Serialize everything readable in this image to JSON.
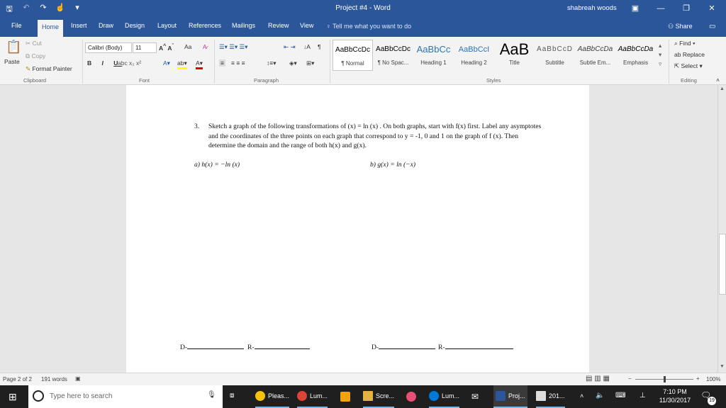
{
  "window": {
    "title": "Project #4  -  Word",
    "user": "shabreah woods"
  },
  "tabs": [
    {
      "label": "File"
    },
    {
      "label": "Home",
      "active": true
    },
    {
      "label": "Insert"
    },
    {
      "label": "Draw"
    },
    {
      "label": "Design"
    },
    {
      "label": "Layout"
    },
    {
      "label": "References"
    },
    {
      "label": "Mailings"
    },
    {
      "label": "Review"
    },
    {
      "label": "View"
    }
  ],
  "tell_me": "Tell me what you want to do",
  "share_label": "Share",
  "ribbon": {
    "clipboard": {
      "paste": "Paste",
      "cut": "Cut",
      "copy": "Copy",
      "format_painter": "Format Painter",
      "label": "Clipboard"
    },
    "font": {
      "name": "Calibri (Body)",
      "size": "11",
      "label": "Font",
      "change_case": "Aa"
    },
    "paragraph": {
      "label": "Paragraph"
    },
    "styles": {
      "label": "Styles",
      "items": [
        {
          "preview": "AaBbCcDc",
          "name": "¶ Normal"
        },
        {
          "preview": "AaBbCcDc",
          "name": "¶ No Spac..."
        },
        {
          "preview": "AaBbCc",
          "name": "Heading 1"
        },
        {
          "preview": "AaBbCcI",
          "name": "Heading 2"
        },
        {
          "preview": "AaB",
          "name": "Title"
        },
        {
          "preview": "AaBbCcD",
          "name": "Subtitle"
        },
        {
          "preview": "AaBbCcDa",
          "name": "Subtle Em..."
        },
        {
          "preview": "AaBbCcDa",
          "name": "Emphasis"
        }
      ]
    },
    "editing": {
      "find": "Find",
      "replace": "Replace",
      "select": "Select",
      "label": "Editing"
    }
  },
  "document": {
    "question_number": "3.",
    "question_text": "Sketch a graph of the following transformations of (x) = ln (x) . On both graphs, start with f(x) first. Label any asymptotes and the coordinates of the three points on each graph that correspond to y = -1, 0 and 1 on the graph of f (x). Then determine the domain and the range of both h(x) and g(x).",
    "part_a": "a)   h(x) = −ln (x)",
    "part_b": "b) g(x) = ln (−x)",
    "domain_label": "D-",
    "range_label": "R-"
  },
  "status": {
    "page": "Page 2 of 2",
    "words": "191 words",
    "zoom": "100%"
  },
  "taskbar": {
    "search_placeholder": "Type here to search",
    "apps": [
      {
        "label": "Pleas..."
      },
      {
        "label": "Lum..."
      },
      {
        "label": "Scre..."
      },
      {
        "label": "Lum..."
      },
      {
        "label": "Proj..."
      },
      {
        "label": "201..."
      }
    ],
    "time": "7:10 PM",
    "date": "11/30/2017",
    "notifications": "19"
  }
}
